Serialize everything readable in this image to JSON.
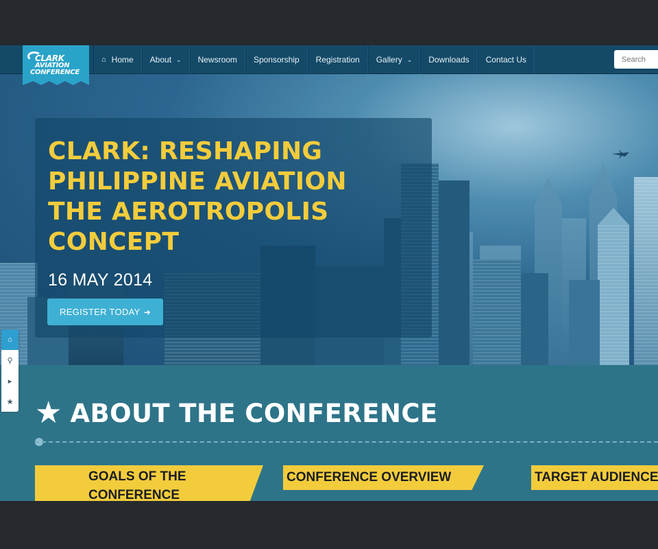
{
  "logo": {
    "line1": "CLARK",
    "line2": "AVIATION",
    "line3": "CONFERENCE"
  },
  "nav": {
    "items": [
      {
        "label": "Home",
        "icon": "home-icon"
      },
      {
        "label": "About",
        "dropdown": true
      },
      {
        "label": "Newsroom"
      },
      {
        "label": "Sponsorship"
      },
      {
        "label": "Registration"
      },
      {
        "label": "Gallery",
        "dropdown": true
      },
      {
        "label": "Downloads"
      },
      {
        "label": "Contact Us"
      }
    ],
    "search_placeholder": "Search"
  },
  "hero": {
    "title_lines": [
      "CLARK: RESHAPING",
      "PHILIPPINE AVIATION",
      "THE AEROTROPOLIS",
      "CONCEPT"
    ],
    "date": "16 MAY 2014",
    "cta": "REGISTER TODAY"
  },
  "dock": [
    "home-icon",
    "map-pin-icon",
    "megaphone-icon",
    "star-icon"
  ],
  "about": {
    "title": "ABOUT THE CONFERENCE",
    "tabs": [
      "GOALS OF THE CONFERENCE",
      "CONFERENCE OVERVIEW",
      "TARGET AUDIENCE"
    ],
    "goals_lines": [
      "GOALS OF THE",
      "CONFERENCE"
    ]
  },
  "colors": {
    "nav_bg": "#144a68",
    "logo_bg": "#2aa3c9",
    "accent_yellow": "#f3cc3c",
    "cta_blue": "#3eb0d4",
    "section_bg": "#2e7489",
    "outer_bg": "#26292e"
  }
}
